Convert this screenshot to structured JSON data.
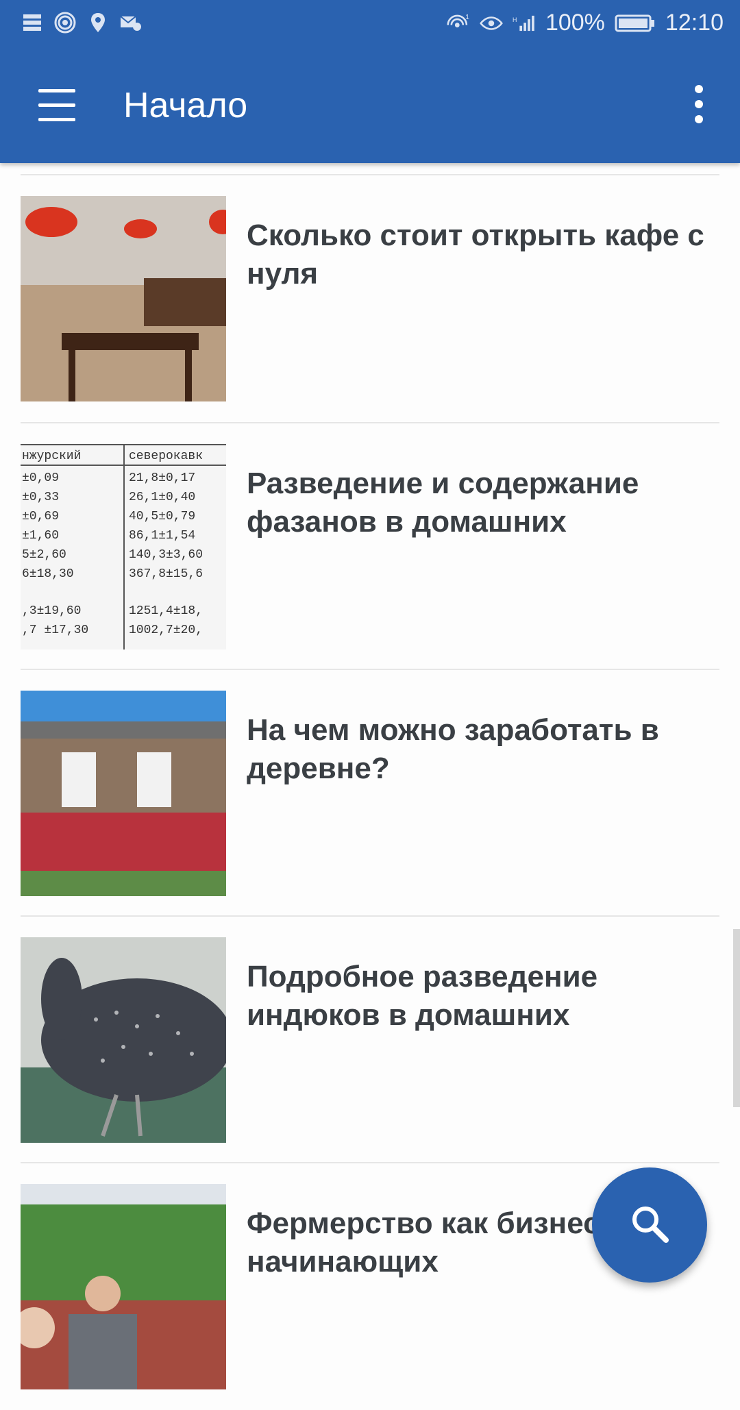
{
  "status_bar": {
    "battery": "100%",
    "time": "12:10"
  },
  "app_bar": {
    "title": "Начало"
  },
  "articles": [
    {
      "title": "Сколько стоит открыть кафе с нуля"
    },
    {
      "title": "Разведение и содержание фазанов в домашних"
    },
    {
      "title": "На чем можно заработать в деревне?"
    },
    {
      "title": "Подробное разведение индюков в домашних"
    },
    {
      "title": "Фермерство как бизнес для начинающих"
    }
  ],
  "thumb_table": {
    "headers": [
      "нжурский",
      "северокавк"
    ],
    "rows": [
      [
        "±0,09",
        "21,8±0,17"
      ],
      [
        "±0,33",
        "26,1±0,40"
      ],
      [
        "±0,69",
        "40,5±0,79"
      ],
      [
        "±1,60",
        "86,1±1,54"
      ],
      [
        "5±2,60",
        "140,3±3,60"
      ],
      [
        "6±18,30",
        "367,8±15,6"
      ],
      [
        ",3±19,60",
        "1251,4±18,"
      ],
      [
        ",7 ±17,30",
        "1002,7±20,"
      ]
    ]
  },
  "colors": {
    "primary": "#2a62b0",
    "title_text": "#3a3f44"
  },
  "icons": {
    "menu": "hamburger-menu-icon",
    "more": "more-vert-icon",
    "search": "search-icon"
  }
}
